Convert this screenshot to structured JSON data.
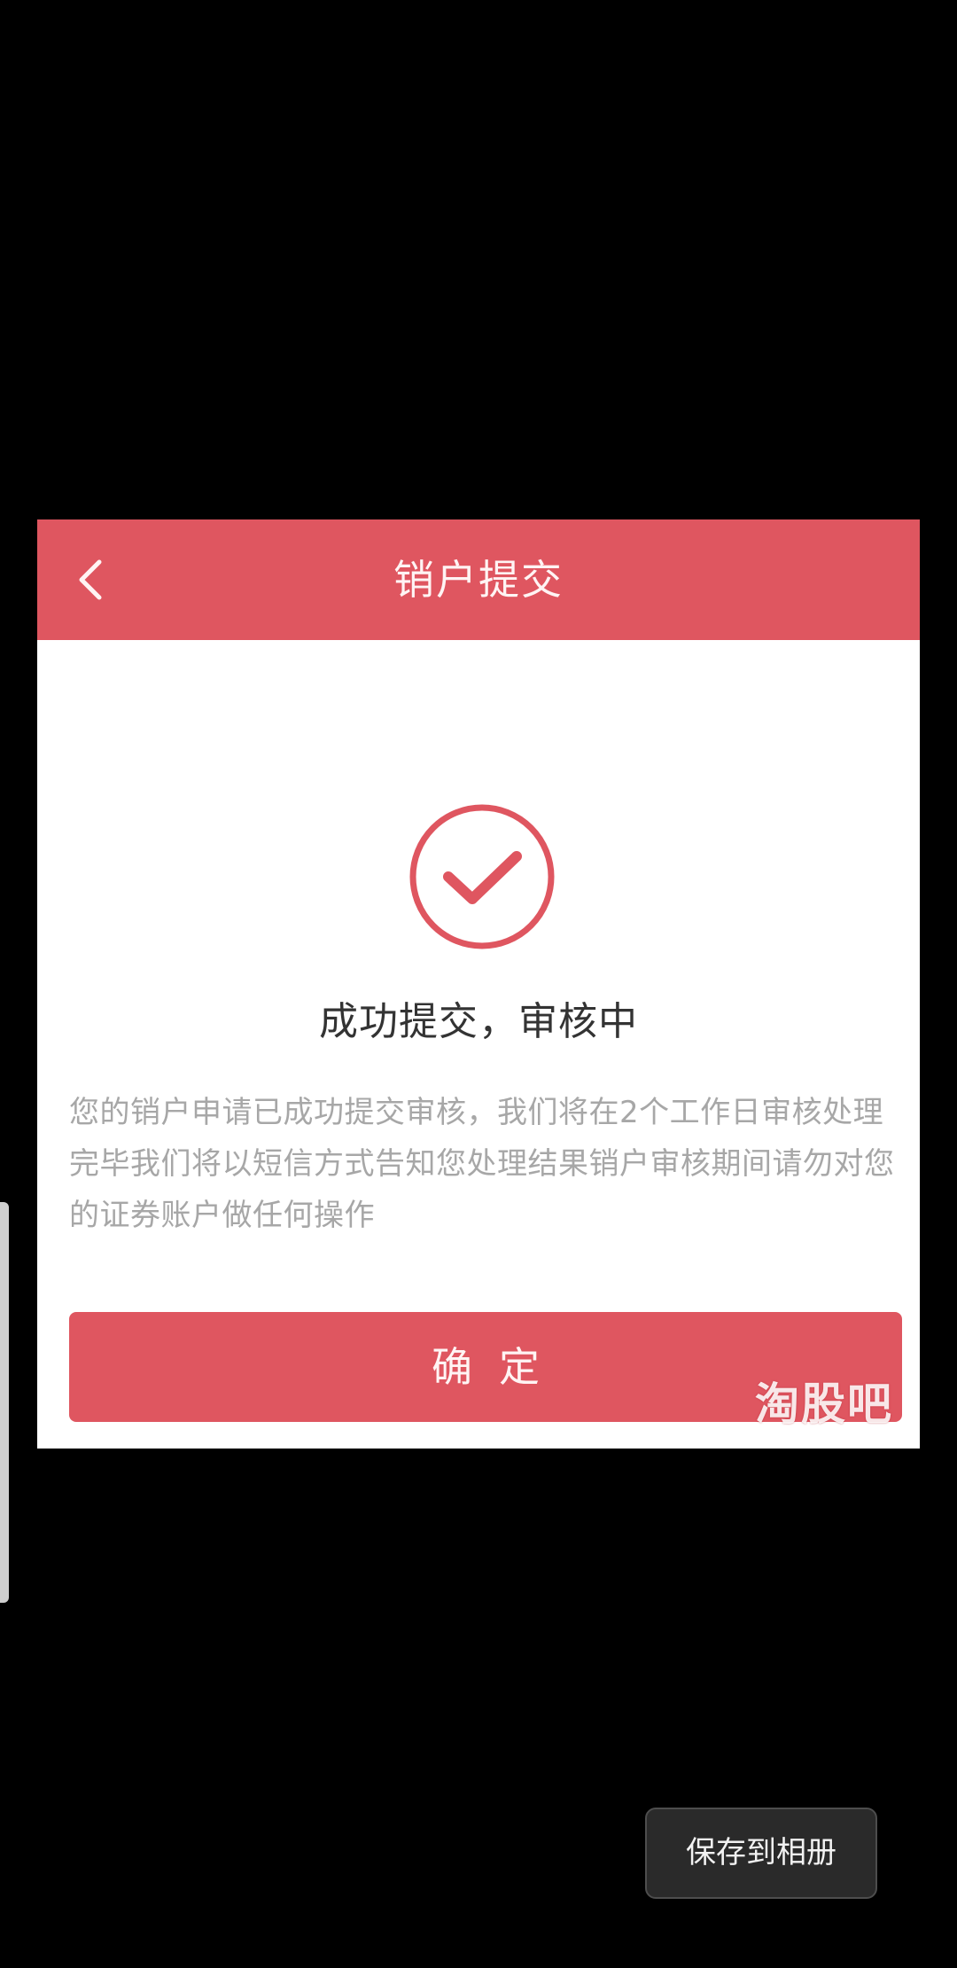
{
  "header": {
    "title": "销户提交",
    "back_icon": "chevron-left-icon"
  },
  "status": {
    "icon": "check-circle-icon",
    "title": "成功提交，审核中",
    "description": "您的销户申请已成功提交审核，我们将在2个工作日审核处理完毕我们将以短信方式告知您处理结果销户审核期间请勿对您的证券账户做任何操作"
  },
  "confirm_button": {
    "label": "确定"
  },
  "watermark": {
    "text": "淘股吧"
  },
  "viewer": {
    "save_label": "保存到相册"
  },
  "colors": {
    "accent": "#df5660",
    "background": "#000000",
    "card": "#ffffff",
    "text_primary": "#333333",
    "text_secondary": "#a7a7a7"
  }
}
